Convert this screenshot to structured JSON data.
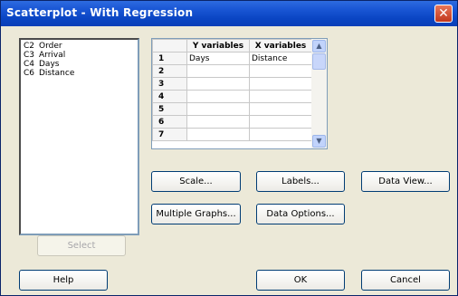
{
  "window": {
    "title": "Scatterplot - With Regression",
    "close_glyph": "✕"
  },
  "variables": [
    {
      "col": "C2",
      "name": "Order"
    },
    {
      "col": "C3",
      "name": "Arrival"
    },
    {
      "col": "C4",
      "name": "Days"
    },
    {
      "col": "C6",
      "name": "Distance"
    }
  ],
  "grid": {
    "headers": {
      "y": "Y variables",
      "x": "X variables"
    },
    "rows": [
      {
        "n": "1",
        "y": "Days",
        "x": "Distance"
      },
      {
        "n": "2",
        "y": "",
        "x": ""
      },
      {
        "n": "3",
        "y": "",
        "x": ""
      },
      {
        "n": "4",
        "y": "",
        "x": ""
      },
      {
        "n": "5",
        "y": "",
        "x": ""
      },
      {
        "n": "6",
        "y": "",
        "x": ""
      },
      {
        "n": "7",
        "y": "",
        "x": ""
      }
    ],
    "scroll_up": "▲",
    "scroll_down": "▼"
  },
  "buttons": {
    "scale": "Scale...",
    "labels": "Labels...",
    "data_view": "Data View...",
    "multiple_graphs": "Multiple Graphs...",
    "data_options": "Data Options...",
    "select": "Select",
    "help": "Help",
    "ok": "OK",
    "cancel": "Cancel"
  }
}
